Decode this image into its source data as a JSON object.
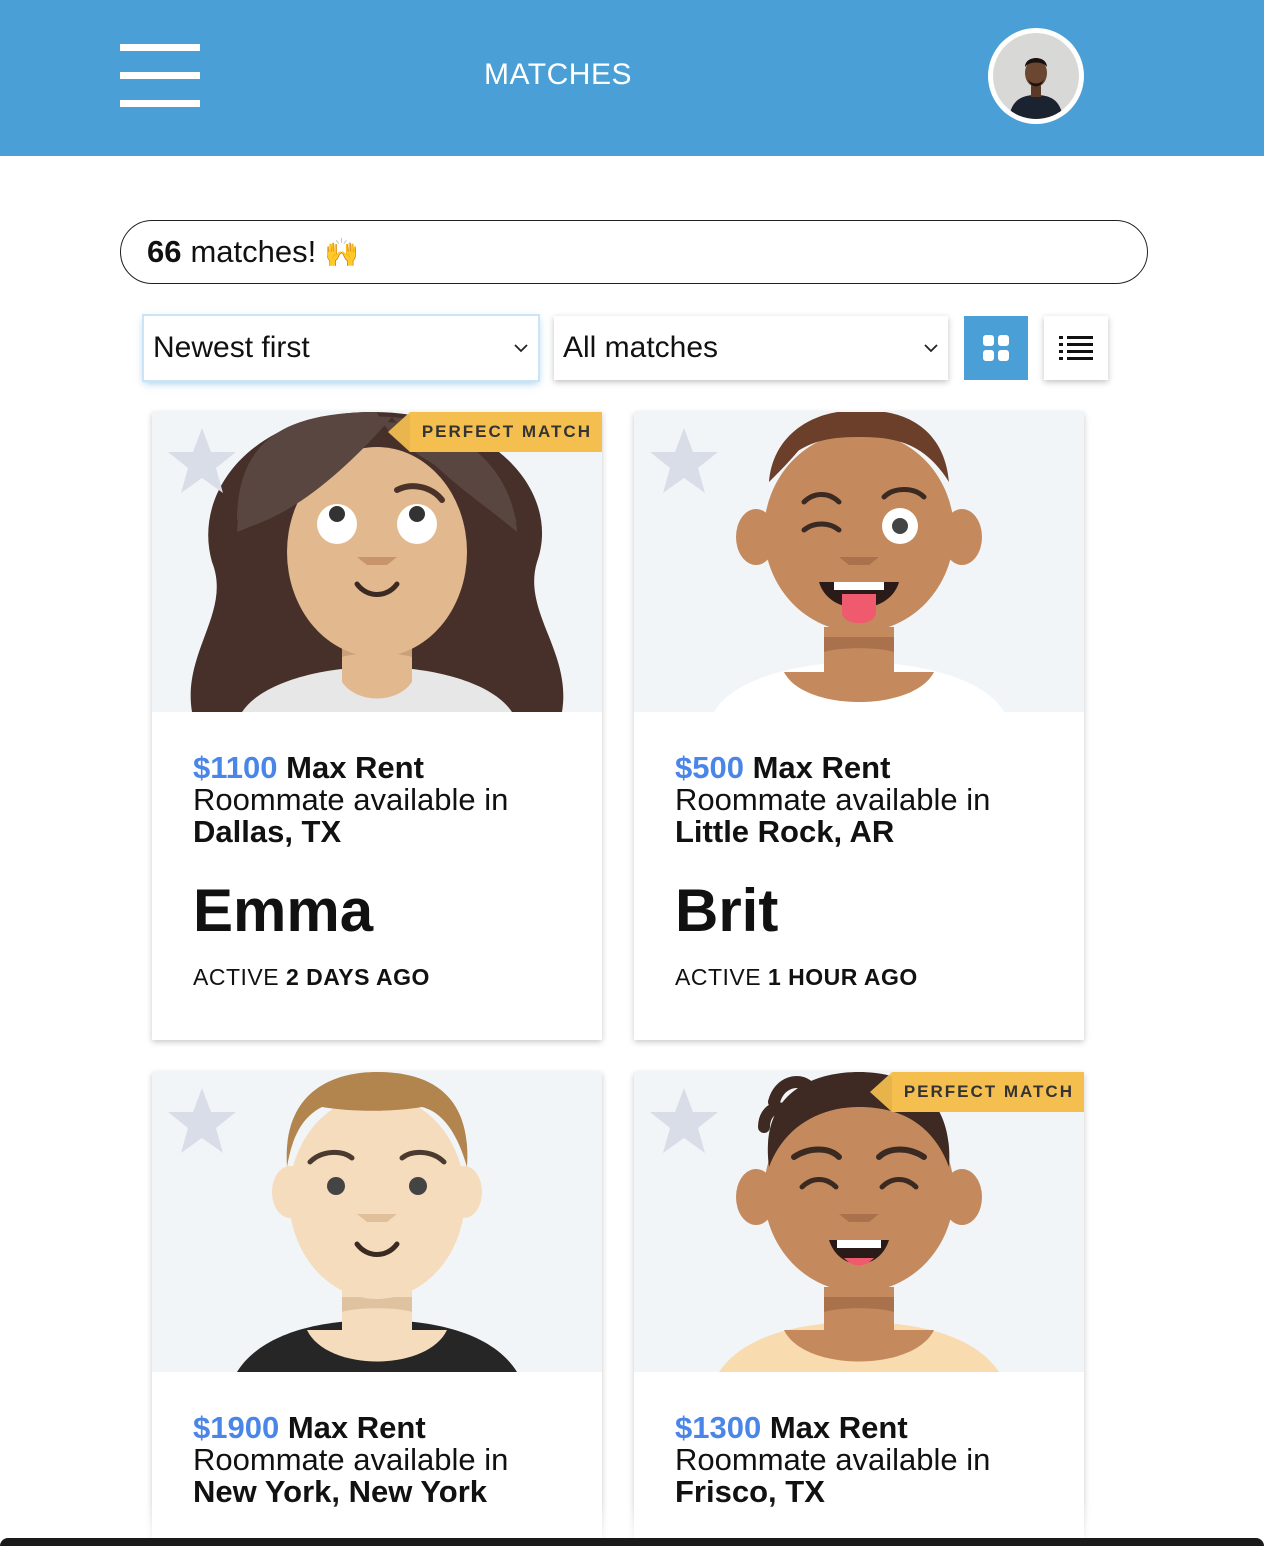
{
  "header": {
    "title": "MATCHES"
  },
  "summary": {
    "count": "66",
    "text": "matches!",
    "emoji": "🙌"
  },
  "controls": {
    "sort_selected": "Newest first",
    "filter_selected": "All matches",
    "view_mode": "grid"
  },
  "rent_suffix": "Max Rent",
  "available_text": "Roommate available in",
  "active_prefix": "ACTIVE",
  "colors": {
    "header": "#4aa0d6",
    "price": "#4a86e8",
    "badge": "#f5bf4f"
  },
  "cards": [
    {
      "name": "Emma",
      "price": "$1100",
      "location": "Dallas, TX",
      "active": "2 DAYS AGO",
      "badge": "PERFECT MATCH"
    },
    {
      "name": "Brit",
      "price": "$500",
      "location": "Little Rock, AR",
      "active": "1 HOUR AGO",
      "badge": ""
    },
    {
      "name": "",
      "price": "$1900",
      "location": "New York, New York",
      "active": "",
      "badge": ""
    },
    {
      "name": "",
      "price": "$1300",
      "location": "Frisco, TX",
      "active": "",
      "badge": "PERFECT MATCH"
    }
  ]
}
